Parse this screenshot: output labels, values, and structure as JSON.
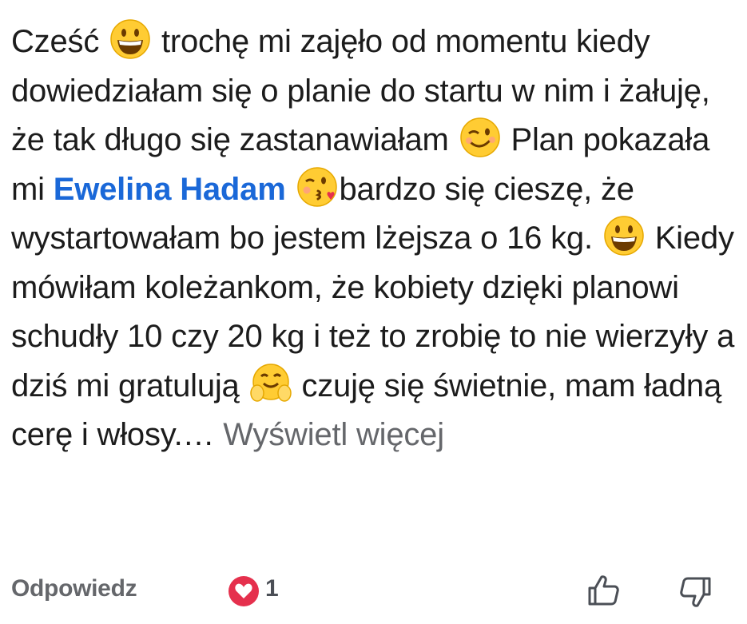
{
  "comment": {
    "part1": "Cześć ",
    "part2": " trochę mi zajęło od momentu kiedy dowiedziałam się o planie do startu w nim i żałuję, że tak długo się zastanawiałam ",
    "part3": " Plan pokazała mi ",
    "mention": "Ewelina Hadam",
    "part4": " ",
    "part5": "bardzo się cieszę, że wystartowałam bo jestem lżejsza o 16 kg. ",
    "part6": " Kiedy mówiłam koleżankom, że kobiety dzięki planowi schudły 10 czy 20 kg i też to zrobię to nie wierzyły a dziś mi gratulują ",
    "part7": " czuję się świetnie, mam ładną cerę i włosy.… ",
    "see_more": "Wyświetl więcej"
  },
  "emojis": [
    "grinning-face",
    "winking-face",
    "face-blowing-kiss",
    "grinning-face",
    "hugging-face"
  ],
  "footer": {
    "reply_label": "Odpowiedz",
    "reaction_count": "1",
    "reaction_type": "love-heart"
  },
  "colors": {
    "mention": "#1a68d8",
    "muted": "#65676b",
    "heart": "#e5304d"
  }
}
